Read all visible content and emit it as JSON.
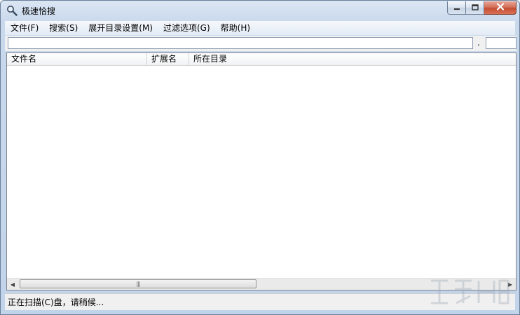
{
  "window": {
    "title": "极速恰搜"
  },
  "menu": {
    "items": [
      {
        "label": "文件(F)"
      },
      {
        "label": "搜索(S)"
      },
      {
        "label": "展开目录设置(M)"
      },
      {
        "label": "过滤选项(G)"
      },
      {
        "label": "帮助(H)"
      }
    ]
  },
  "search": {
    "value": "",
    "separator": ".",
    "extension_value": ""
  },
  "list": {
    "columns": [
      {
        "label": "文件名"
      },
      {
        "label": "扩展名"
      },
      {
        "label": "所在目录"
      }
    ],
    "rows": [],
    "hscroll_thumb_fraction": 0.49
  },
  "status": {
    "text": "正在扫描(C)盘，请稍候..."
  },
  "colors": {
    "frame": "#c2d4ea",
    "close_button": "#c44d33"
  },
  "icons": {
    "title": "magnifier-icon",
    "minimize": "minimize-icon",
    "maximize": "maximize-icon",
    "close": "close-icon"
  }
}
